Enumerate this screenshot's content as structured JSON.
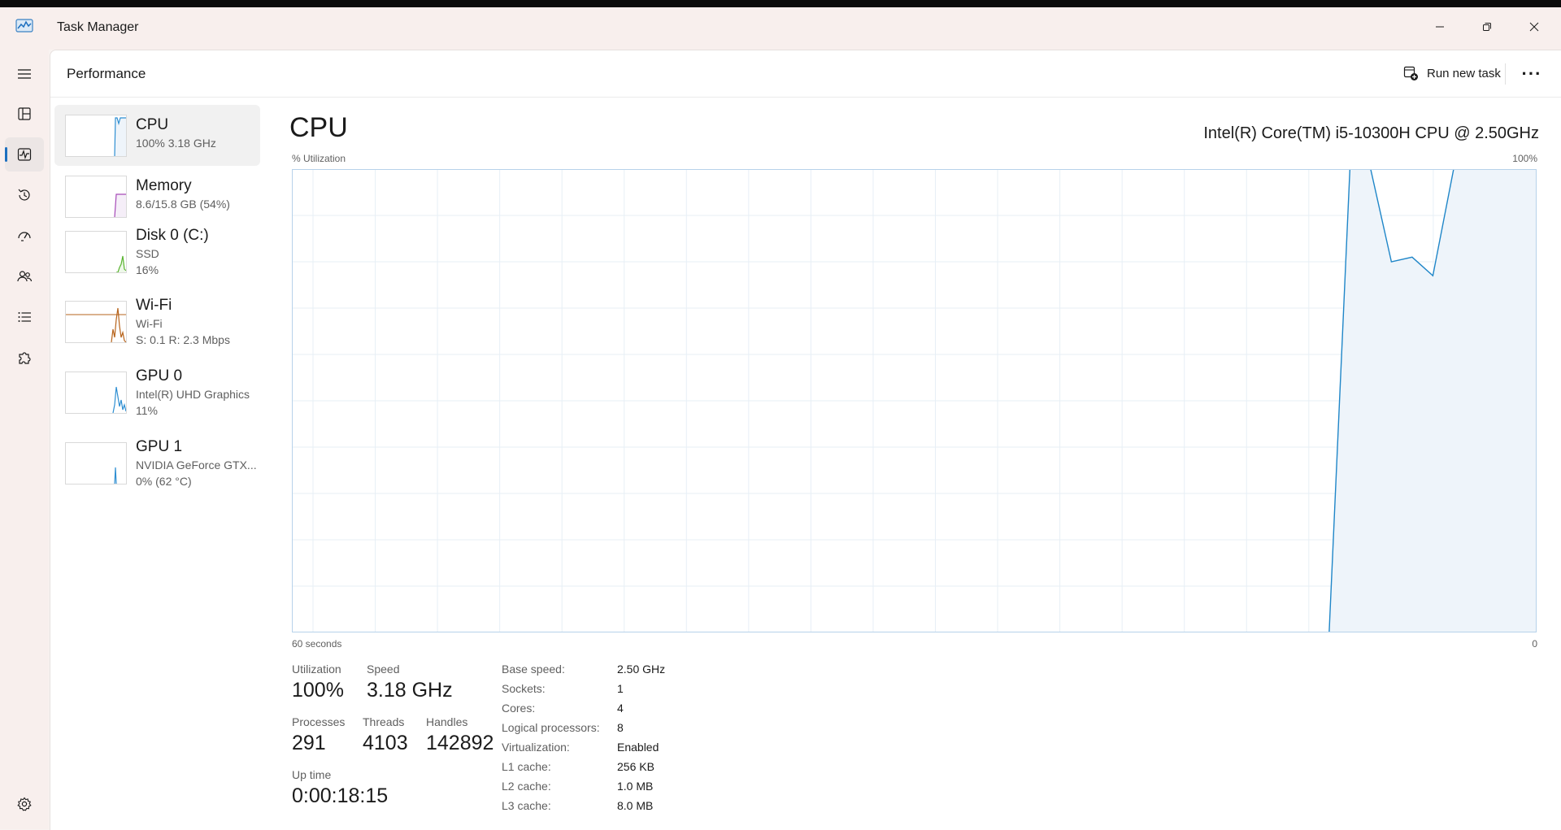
{
  "window": {
    "title": "Task Manager",
    "minimize_icon": "minimize-icon",
    "restore_icon": "restore-icon",
    "close_icon": "close-icon"
  },
  "header": {
    "title": "Performance",
    "run_task_label": "Run new task",
    "more_label": "···"
  },
  "nav": {
    "items": [
      "menu",
      "processes",
      "performance",
      "app-history",
      "startup-apps",
      "users",
      "details",
      "services"
    ],
    "active": "performance",
    "settings": "settings",
    "accent": "#1c6fbf"
  },
  "devices": [
    {
      "name": "CPU",
      "line1": "100%  3.18 GHz",
      "line2": "",
      "color": "#2f8fd2",
      "active": true
    },
    {
      "name": "Memory",
      "line1": "8.6/15.8 GB (54%)",
      "line2": "",
      "color": "#a64ab8",
      "active": false
    },
    {
      "name": "Disk 0 (C:)",
      "line1": "SSD",
      "line2": "16%",
      "color": "#5ab431",
      "active": false
    },
    {
      "name": "Wi-Fi",
      "line1": "Wi-Fi",
      "line2": "S: 0.1  R: 2.3 Mbps",
      "color": "#b7641c",
      "active": false
    },
    {
      "name": "GPU 0",
      "line1": "Intel(R) UHD Graphics",
      "line2": "11%",
      "color": "#2f8fd2",
      "active": false
    },
    {
      "name": "GPU 1",
      "line1": "NVIDIA GeForce GTX...",
      "line2": "0%  (62 °C)",
      "color": "#2f8fd2",
      "active": false
    }
  ],
  "cpu": {
    "title": "CPU",
    "model": "Intel(R) Core(TM) i5-10300H CPU @ 2.50GHz",
    "graph_top_left": "% Utilization",
    "graph_top_right": "100%",
    "graph_bottom_left": "60 seconds",
    "graph_bottom_right": "0",
    "line_color": "#1f86c8",
    "fill_color": "#eef4fa"
  },
  "chart_data": {
    "type": "area",
    "x": [
      60,
      59,
      58,
      57,
      56,
      55,
      54,
      53,
      52,
      51,
      50,
      49,
      48,
      47,
      46,
      45,
      44,
      43,
      42,
      41,
      40,
      39,
      38,
      37,
      36,
      35,
      34,
      33,
      32,
      31,
      30,
      29,
      28,
      27,
      26,
      25,
      24,
      23,
      22,
      21,
      20,
      19,
      18,
      17,
      16,
      15,
      14,
      13,
      12,
      11,
      10,
      9,
      8,
      7,
      6,
      5,
      4,
      3,
      2,
      1,
      0
    ],
    "values": [
      null,
      null,
      null,
      null,
      null,
      null,
      null,
      null,
      null,
      null,
      null,
      null,
      null,
      null,
      null,
      null,
      null,
      null,
      null,
      null,
      null,
      null,
      null,
      null,
      null,
      null,
      null,
      null,
      null,
      null,
      null,
      null,
      null,
      null,
      null,
      null,
      null,
      null,
      null,
      null,
      null,
      null,
      null,
      null,
      null,
      null,
      null,
      null,
      null,
      null,
      0,
      100,
      100,
      80,
      81,
      77,
      100,
      100,
      100,
      100,
      100
    ],
    "title": "",
    "xlabel": "60 seconds",
    "ylabel": "% Utilization",
    "ylim": [
      0,
      100
    ],
    "grid": true
  },
  "stats": {
    "utilization_label": "Utilization",
    "utilization_value": "100%",
    "speed_label": "Speed",
    "speed_value": "3.18 GHz",
    "processes_label": "Processes",
    "processes_value": "291",
    "threads_label": "Threads",
    "threads_value": "4103",
    "handles_label": "Handles",
    "handles_value": "142892",
    "uptime_label": "Up time",
    "uptime_value": "0:00:18:15"
  },
  "specs": [
    {
      "label": "Base speed:",
      "value": "2.50 GHz"
    },
    {
      "label": "Sockets:",
      "value": "1"
    },
    {
      "label": "Cores:",
      "value": "4"
    },
    {
      "label": "Logical processors:",
      "value": "8"
    },
    {
      "label": "Virtualization:",
      "value": "Enabled"
    },
    {
      "label": "L1 cache:",
      "value": "256 KB"
    },
    {
      "label": "L2 cache:",
      "value": "1.0 MB"
    },
    {
      "label": "L3 cache:",
      "value": "8.0 MB"
    }
  ]
}
